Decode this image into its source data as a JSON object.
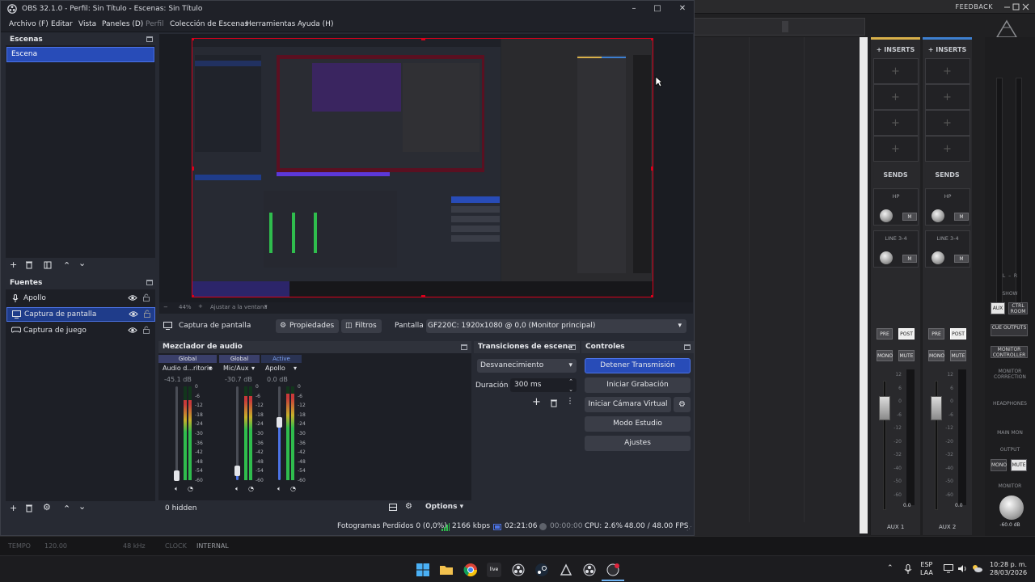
{
  "obs": {
    "window_title": "OBS 32.1.0 - Perfil: Sin Título - Escenas: Sin Título",
    "menu": [
      "Archivo (F)",
      "Editar",
      "Vista",
      "Paneles (D)",
      "Perfil",
      "Colección de Escenas",
      "Herramientas",
      "Ayuda (H)"
    ],
    "scenes": {
      "title": "Escenas",
      "items": [
        "Escena"
      ]
    },
    "sources": {
      "title": "Fuentes",
      "items": [
        {
          "label": "Apollo",
          "icon": "microphone-icon"
        },
        {
          "label": "Captura de pantalla",
          "icon": "monitor-icon"
        },
        {
          "label": "Captura de juego",
          "icon": "gamepad-icon"
        }
      ]
    },
    "zoom": {
      "value": "44%",
      "fit_label": "Ajustar a la ventana"
    },
    "properties_bar": {
      "source_name": "Captura de pantalla",
      "properties_label": "Propiedades",
      "filters_label": "Filtros",
      "display_label": "Pantalla",
      "display_value": "GF220C: 1920x1080 @ 0,0 (Monitor principal)"
    },
    "mixer": {
      "title": "Mezclador de audio",
      "channels": [
        {
          "badge": "Global",
          "name": "Audio d...ritorio",
          "db": "-45.1 dB",
          "level": 0.05,
          "peak": 0.85
        },
        {
          "badge": "Global",
          "name": "Mic/Aux",
          "db": "-30.7 dB",
          "level": 0.1,
          "peak": 0.9
        },
        {
          "badge": "Active",
          "name": "Apollo",
          "db": "0.0 dB",
          "level": 0.62,
          "peak": 0.92
        }
      ],
      "scale": [
        "0",
        "-6",
        "-12",
        "-18",
        "-24",
        "-30",
        "-36",
        "-42",
        "-48",
        "-54",
        "-60"
      ],
      "hidden_label": "0 hidden",
      "options_label": "Options"
    },
    "transitions": {
      "title": "Transiciones de escena",
      "selected": "Desvanecimiento",
      "duration_label": "Duración",
      "duration_value": "300 ms"
    },
    "controls": {
      "title": "Controles",
      "buttons": [
        "Detener Transmisión",
        "Iniciar Grabación",
        "Iniciar Cámara Virtual",
        "Modo Estudio",
        "Ajustes"
      ]
    },
    "status": {
      "dropped_frames": "Fotogramas Perdidos 0 (0,0%)",
      "bitrate": "2166 kbps",
      "stream_time": "02:21:06",
      "rec_time": "00:00:00",
      "cpu": "CPU: 2.6%",
      "fps": "48.00 / 48.00 FPS"
    }
  },
  "ua_console": {
    "feedback_label": "FEEDBACK",
    "inserts_label": "INSERTS",
    "sends_label": "SENDS",
    "send_hp": "HP",
    "send_line": "LINE 3-4",
    "mute_short": "M",
    "pre_label": "PRE",
    "post_label": "POST",
    "mono_label": "MONO",
    "mute_label": "MUTE",
    "aux1": "AUX 1",
    "aux2": "AUX 2",
    "fader_value": "0.0",
    "fader_scale": [
      "12",
      "6",
      "0",
      "-6",
      "-12",
      "-20",
      "-32",
      "-40",
      "-50",
      "-60"
    ],
    "right_panel": {
      "show": "SHOW",
      "aux": "AUX",
      "ctrl_room": "CTRL ROOM",
      "cue_outputs": "CUE OUTPUTS",
      "monitor_controller": "MONITOR CONTROLLER",
      "monitor_correction": "MONITOR CORRECTION",
      "headphones": "HEADPHONES",
      "main_mon": "MAIN MON",
      "output": "OUTPUT",
      "mono": "MONO",
      "mute": "MUTE",
      "monitor": "MONITOR",
      "monitor_db": "-60.0 dB",
      "l": "L",
      "r": "R"
    },
    "status_strip": {
      "tempo_label": "TEMPO",
      "tempo_value": "120.00",
      "rate_value": "48 kHz",
      "clock_label": "CLOCK",
      "clock_value": "INTERNAL"
    }
  },
  "taskbar": {
    "time": "10:28 p. m.",
    "date": "28/03/2026",
    "lang": "ESP",
    "lang2": "LAA"
  }
}
